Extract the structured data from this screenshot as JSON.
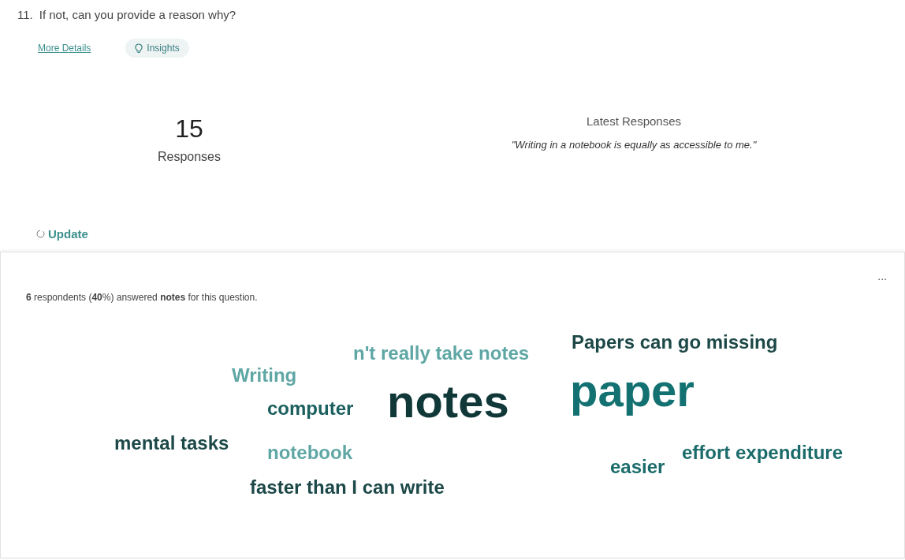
{
  "question": {
    "number": "11.",
    "text": "If not, can you provide a reason why?"
  },
  "links": {
    "more_details": "More Details",
    "insights": "Insights"
  },
  "stats": {
    "count": "15",
    "count_label": "Responses",
    "latest_title": "Latest Responses",
    "latest_quote": "\"Writing in a notebook is equally as accessible to me.\""
  },
  "update": "Update",
  "card": {
    "menu": "...",
    "summary": "**6** respondents (**40**%) answered **notes** for this question.",
    "words": [
      {
        "text": "n't really take notes",
        "kind": "normal",
        "color": "#5fa7a5"
      },
      {
        "text": "Papers can go missing",
        "kind": "normal",
        "color": "#1d4848"
      },
      {
        "text": "Writing",
        "kind": "normal",
        "color": "#5fa7a5"
      },
      {
        "text": "computer",
        "kind": "normal",
        "color": "#1b5f5f"
      },
      {
        "text": "notes",
        "kind": "large",
        "color": "#113838"
      },
      {
        "text": "paper",
        "kind": "large",
        "color": "#147171"
      },
      {
        "text": "mental tasks",
        "kind": "normal",
        "color": "#1d4848"
      },
      {
        "text": "notebook",
        "kind": "normal",
        "color": "#5fa7a5"
      },
      {
        "text": "easier",
        "kind": "normal",
        "color": "#1b6b6b"
      },
      {
        "text": "effort expenditure",
        "kind": "normal",
        "color": "#1b6b6b"
      },
      {
        "text": "faster than I can write",
        "kind": "normal",
        "color": "#1d4848"
      }
    ]
  }
}
